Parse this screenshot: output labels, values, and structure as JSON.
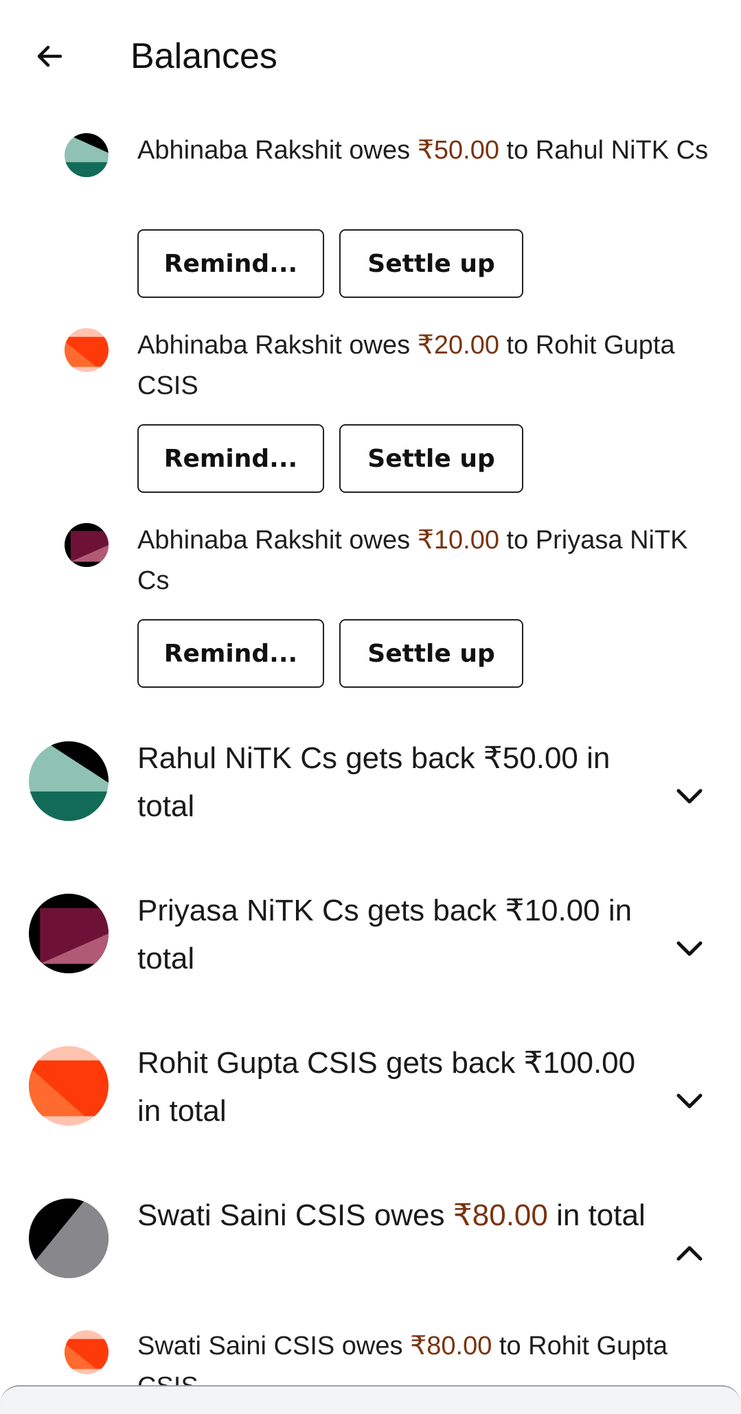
{
  "header": {
    "title": "Balances",
    "back_icon": "arrow-left-icon"
  },
  "debts_top": [
    {
      "debtor": "Abhinaba Rakshit",
      "verb": "owes",
      "amount": "₹50.00",
      "creditor_text": "to Rahul NiTK Cs",
      "remind_label": "Remind...",
      "settle_label": "Settle up",
      "avatar_colors": [
        "#8fc2b3",
        "#000000",
        "#126b58"
      ]
    },
    {
      "debtor": "Abhinaba Rakshit",
      "verb": "owes",
      "amount": "₹20.00",
      "creditor_text": "to Rohit Gupta CSIS",
      "remind_label": "Remind...",
      "settle_label": "Settle up",
      "avatar_colors": [
        "#ffc3b0",
        "#ff3a0a",
        "#ff6a2e"
      ]
    },
    {
      "debtor": "Abhinaba Rakshit",
      "verb": "owes",
      "amount": "₹10.00",
      "creditor_text": "to Priyasa NiTK Cs",
      "remind_label": "Remind...",
      "settle_label": "Settle up",
      "avatar_colors": [
        "#000000",
        "#6d1236",
        "#b05a75"
      ]
    }
  ],
  "groups": [
    {
      "name": "Rahul NiTK Cs",
      "status": "gets back",
      "amount": "₹50.00",
      "suffix": "in total",
      "amount_highlight": false,
      "expanded": false,
      "chevron_icon": "chevron-down-icon",
      "avatar_colors": [
        "#8fc2b3",
        "#000000",
        "#126b58"
      ]
    },
    {
      "name": "Priyasa NiTK Cs",
      "status": "gets back",
      "amount": "₹10.00",
      "suffix": "in total",
      "amount_highlight": false,
      "expanded": false,
      "chevron_icon": "chevron-down-icon",
      "avatar_colors": [
        "#000000",
        "#6d1236",
        "#b05a75"
      ]
    },
    {
      "name": "Rohit Gupta CSIS",
      "status": "gets back",
      "amount": "₹100.00",
      "suffix": "in total",
      "amount_highlight": false,
      "expanded": false,
      "chevron_icon": "chevron-down-icon",
      "avatar_colors": [
        "#ffc3b0",
        "#ff3a0a",
        "#ff6a2e"
      ]
    },
    {
      "name": "Swati Saini CSIS",
      "status": "owes",
      "amount": "₹80.00",
      "suffix": "in total",
      "amount_highlight": true,
      "expanded": true,
      "chevron_icon": "chevron-up-icon",
      "avatar_colors": [
        "#000000",
        "#000000",
        "#88888c"
      ]
    }
  ],
  "debt_bottom": {
    "debtor": "Swati Saini CSIS",
    "verb": "owes",
    "amount": "₹80.00",
    "creditor_text": "to Rohit Gupta CSIS",
    "avatar_colors": [
      "#ffc3b0",
      "#ff3a0a",
      "#ff6a2e"
    ]
  }
}
